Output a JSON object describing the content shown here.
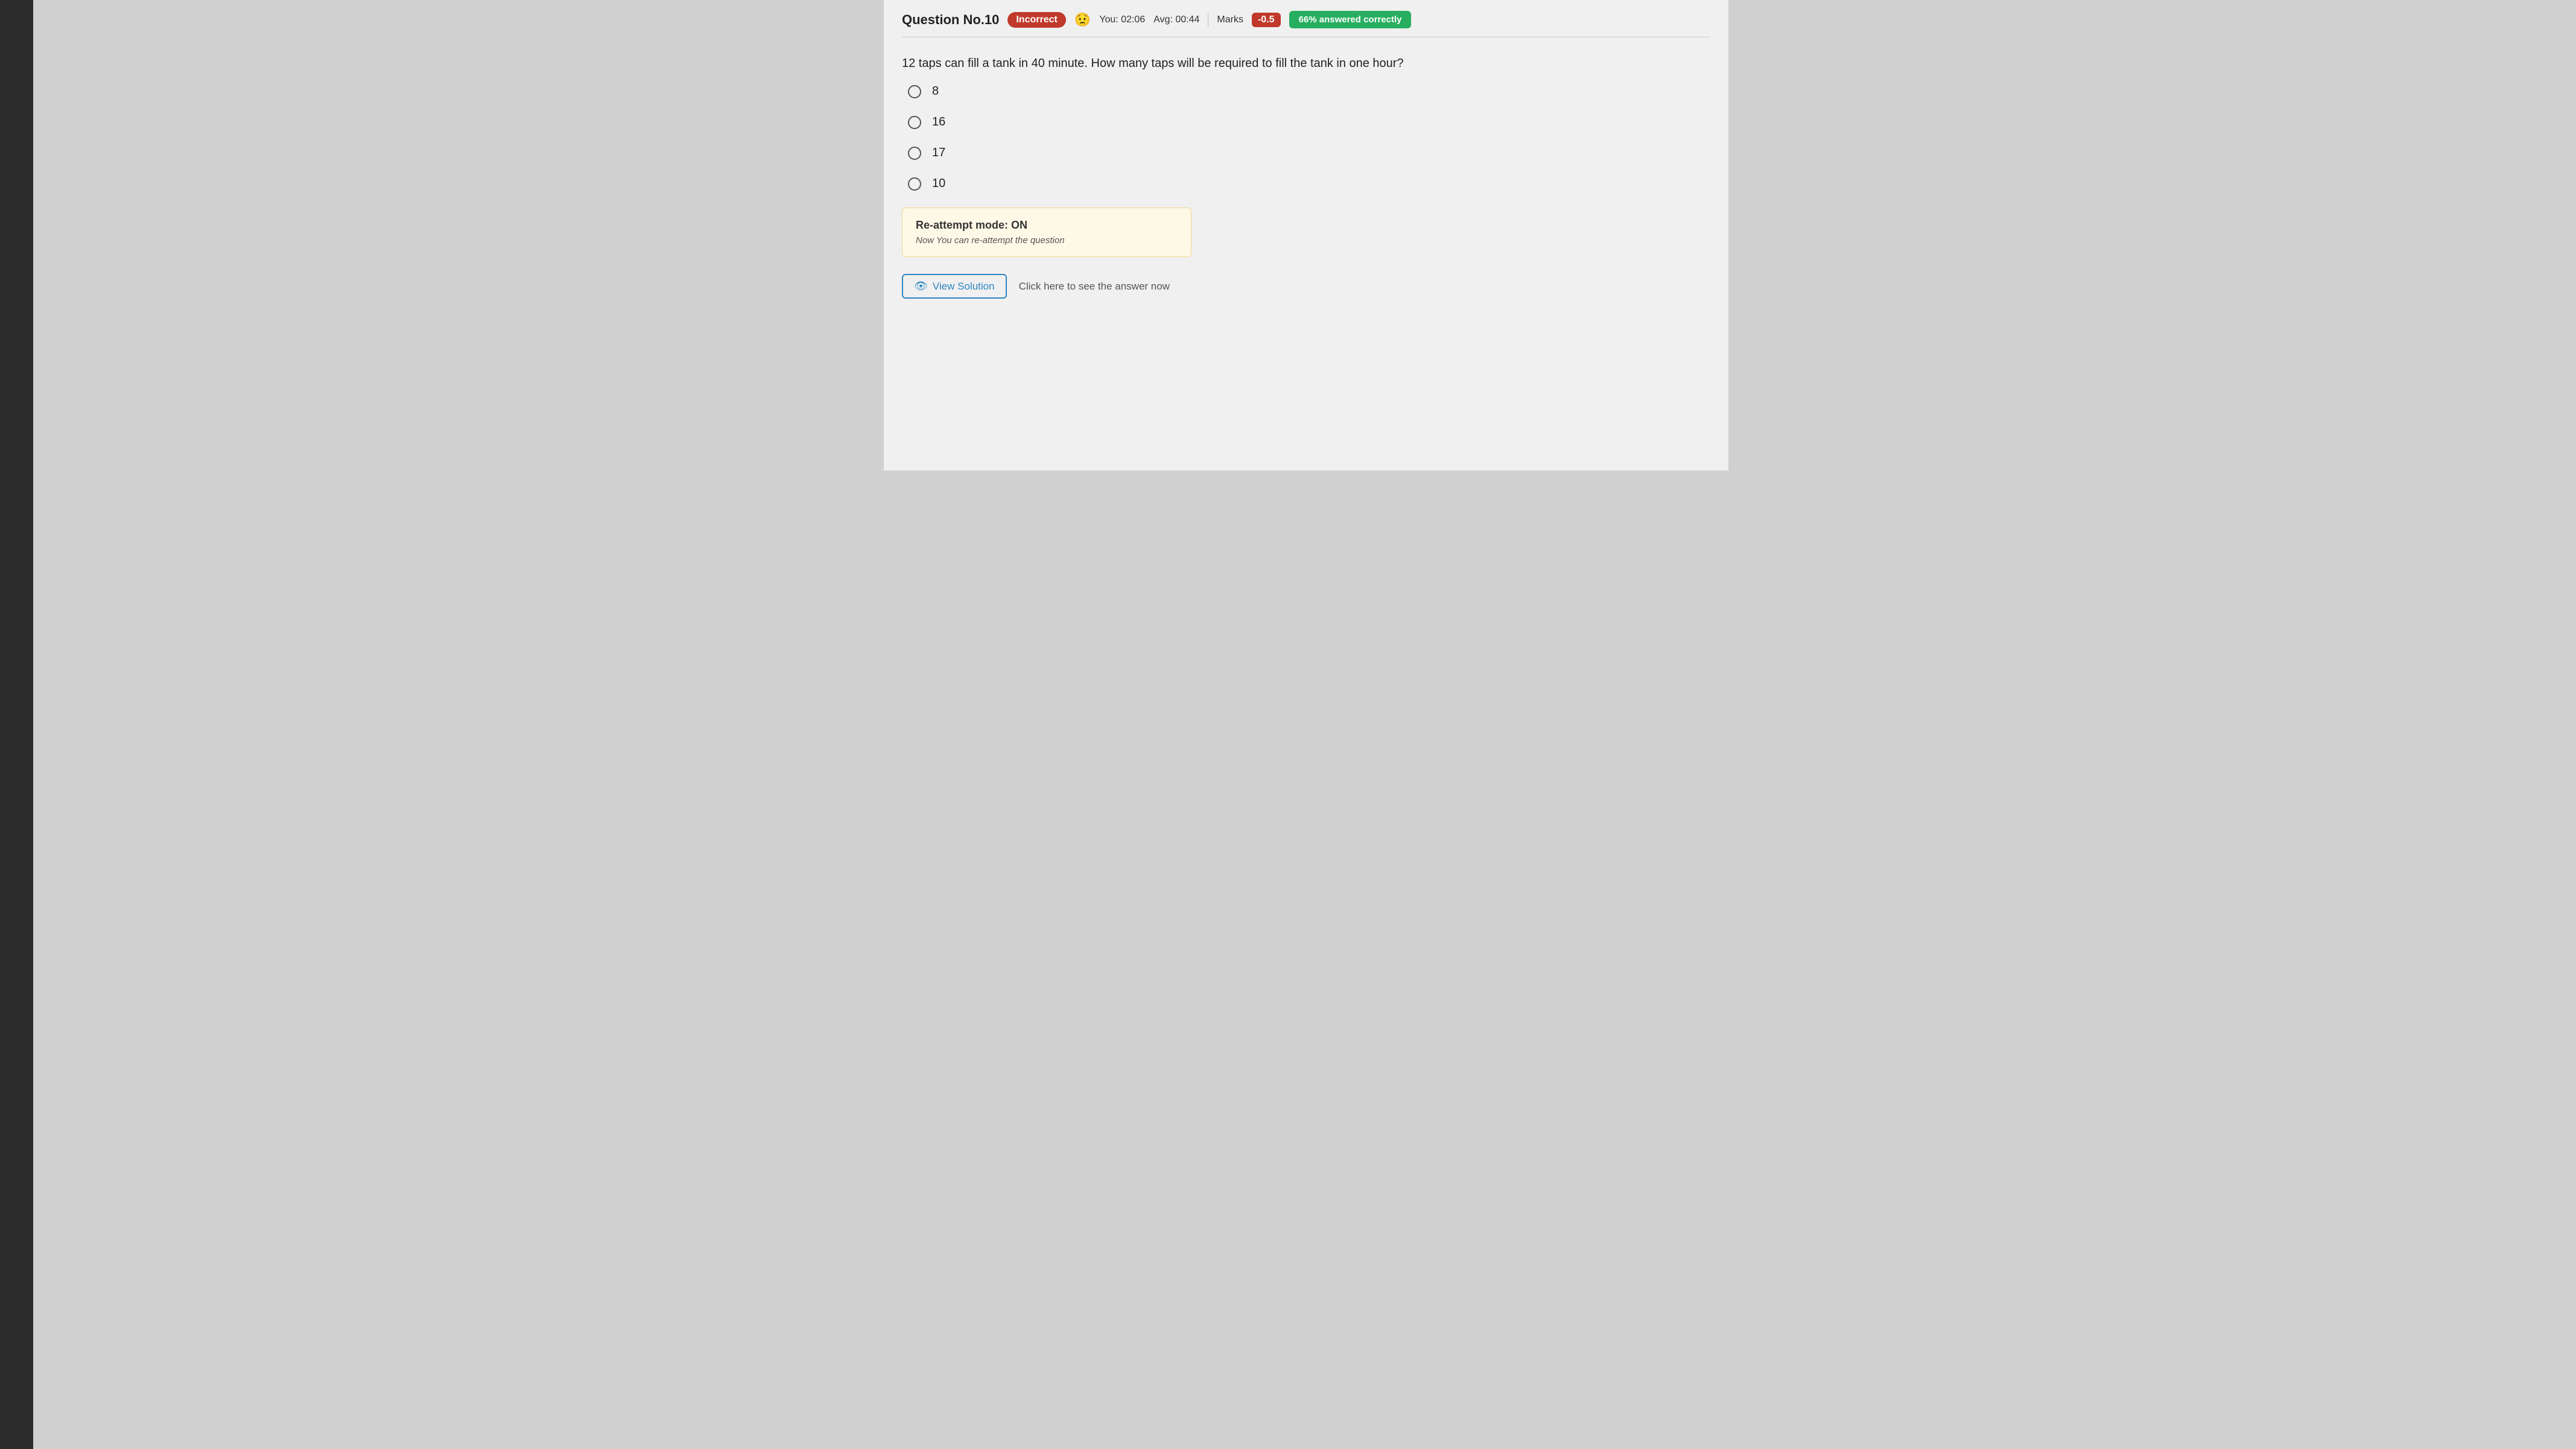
{
  "header": {
    "question_number": "Question No.10",
    "incorrect_label": "Incorrect",
    "emoji": "😟",
    "you_time": "You: 02:06",
    "avg_time": "Avg: 00:44",
    "marks_label": "Marks",
    "marks_value": "-0.5",
    "correct_pct": "66% answered correctly"
  },
  "question": {
    "text": "12 taps can fill a tank in 40 minute. How many taps will be required to fill the tank in one hour?"
  },
  "options": [
    {
      "id": "opt-8",
      "label": "8"
    },
    {
      "id": "opt-16",
      "label": "16"
    },
    {
      "id": "opt-17",
      "label": "17"
    },
    {
      "id": "opt-10",
      "label": "10"
    }
  ],
  "reattempt": {
    "title": "Re-attempt mode: ON",
    "subtitle": "Now You can re-attempt the question"
  },
  "view_solution": {
    "button_label": "View Solution",
    "hint_text": "Click here to see the answer now"
  }
}
